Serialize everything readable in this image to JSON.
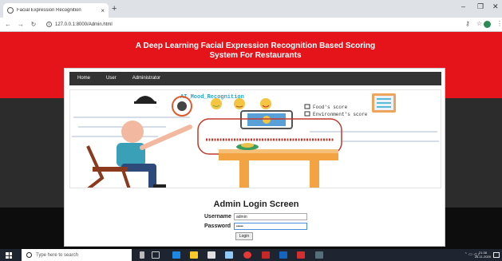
{
  "browser": {
    "tab_title": "Facial Expression Recognition",
    "tab_close": "×",
    "new_tab": "+",
    "url": "127.0.0.1:8000/Admin.html",
    "minimize": "–",
    "maximize": "❐",
    "close": "✕"
  },
  "page": {
    "title_line1": "A Deep Learning Facial Expression Recognition Based Scoring",
    "title_line2": "System For Restaurants",
    "nav": [
      {
        "label": "Home"
      },
      {
        "label": "User"
      },
      {
        "label": "Administrator"
      }
    ],
    "hero": {
      "brand": "AI_Mood_Recognition",
      "legend1": "Food's score",
      "legend2": "Environment's score"
    },
    "login": {
      "heading": "Admin Login Screen",
      "username_label": "Username",
      "username_value": "admin",
      "password_label": "Password",
      "password_value": "•••••",
      "button": "Login"
    }
  },
  "taskbar": {
    "search_placeholder": "Type here to search",
    "time": "21:38",
    "date": "25-11-2020"
  },
  "colors": {
    "header_red": "#e4141a",
    "dark_band": "#2c2c2c",
    "nav_bar": "#333333"
  }
}
